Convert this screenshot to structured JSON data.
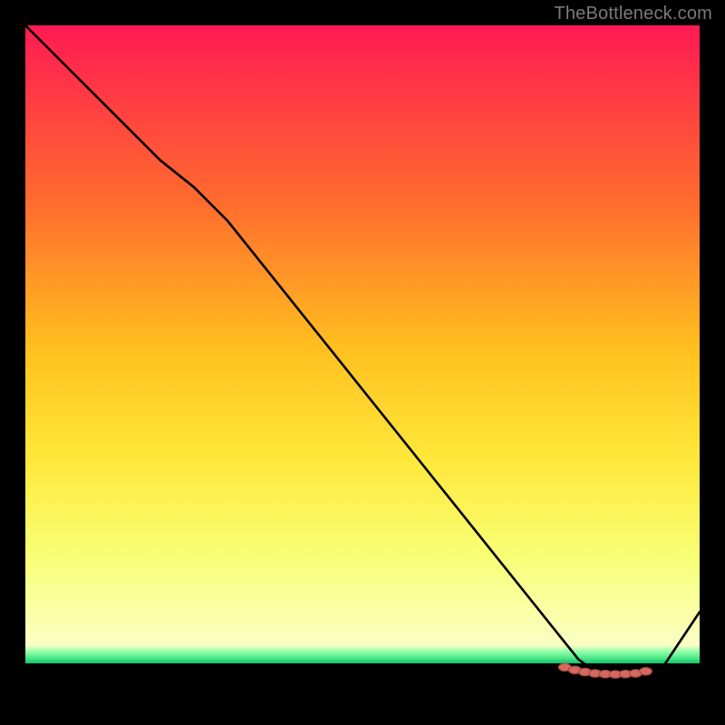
{
  "watermark": "TheBottleneck.com",
  "colors": {
    "background": "#000000",
    "curve": "#000000",
    "dot_fill": "#d46a5f",
    "dot_stroke": "#b14f46",
    "grad_top": "#ff1a53",
    "grad_mid1": "#ff6a2e",
    "grad_mid2": "#ffbf1f",
    "grad_mid3": "#ffe83a",
    "grad_mid4": "#f8ff77",
    "grad_bottom": "#fbffc4",
    "green_light": "#9fffb0",
    "green_mid": "#4de989",
    "green_deep": "#17c06a"
  },
  "layout": {
    "gradient_height_pct": 92,
    "green_top_pct": 92,
    "green_height_pct": 2.6
  },
  "chart_data": {
    "type": "line",
    "title": "",
    "xlabel": "",
    "ylabel": "",
    "xlim": [
      0,
      100
    ],
    "ylim": [
      0,
      100
    ],
    "x": [
      0,
      10,
      20,
      25,
      30,
      40,
      50,
      60,
      70,
      78,
      82,
      86,
      90,
      94,
      100
    ],
    "values": [
      100,
      90,
      80,
      76,
      71,
      58.5,
      46,
      33.5,
      21,
      11,
      6,
      3,
      3,
      4,
      13
    ],
    "dots_x": [
      80,
      81.5,
      83,
      84.5,
      86,
      87.5,
      89,
      90.5,
      92
    ],
    "dots_y": [
      4.8,
      4.4,
      4.1,
      3.9,
      3.8,
      3.75,
      3.8,
      3.9,
      4.2
    ]
  }
}
